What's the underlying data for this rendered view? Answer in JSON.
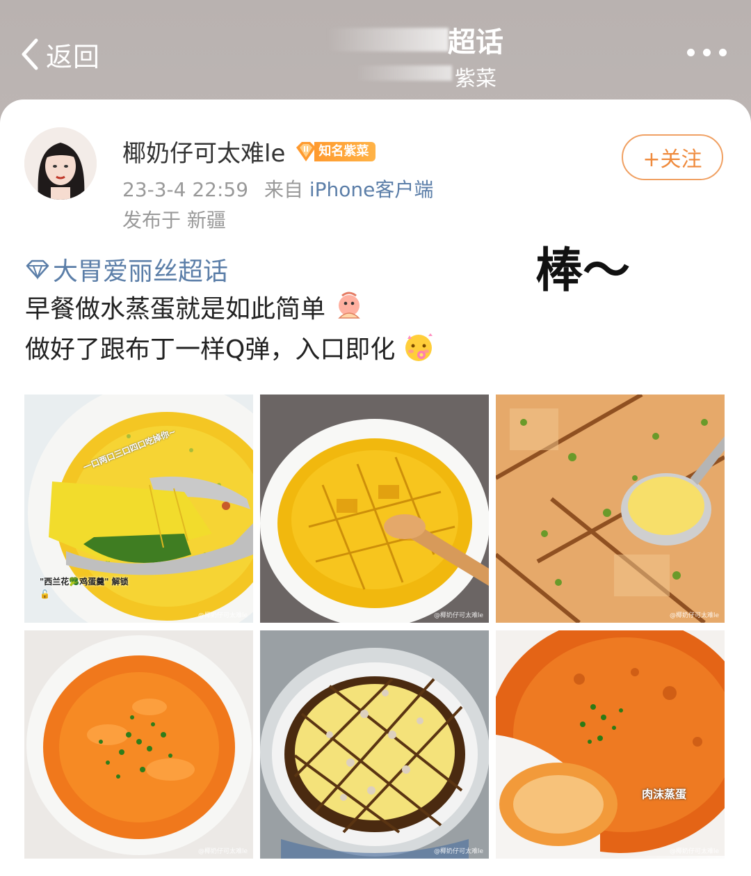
{
  "nav": {
    "back_label": "返回",
    "title": "超话",
    "subtitle": "紫菜"
  },
  "post": {
    "username": "椰奶仔可太难le",
    "badge": "知名紫菜",
    "time": "23-3-4 22:59",
    "from_prefix": "来自",
    "source": "iPhone客户端",
    "location": "发布于 新疆",
    "follow_label": "+关注",
    "topic": "大胃爱丽丝超话",
    "line1": "早餐做水蒸蛋就是如此简单",
    "line2": "做好了跟布丁一样Q弹，入口即化",
    "annotation": "棒～"
  },
  "photos": [
    {
      "overlay_top": "一口两口三口四口吃掉你~",
      "overlay_bottom": "\"西兰花🥦鸡蛋羹\" 解锁🔓",
      "watermark": "@椰奶仔可太难le"
    },
    {
      "watermark": "@椰奶仔可太难le"
    },
    {
      "watermark": "@椰奶仔可太难le"
    },
    {
      "watermark": "@椰奶仔可太难le"
    },
    {
      "watermark": "@椰奶仔可太难le"
    },
    {
      "overlay": "肉沫蒸蛋",
      "watermark": "@椰奶仔可太难le"
    }
  ],
  "colors": {
    "link": "#5b7ea8",
    "follow": "#ef8a3c",
    "badge": "#ff9a2e"
  }
}
